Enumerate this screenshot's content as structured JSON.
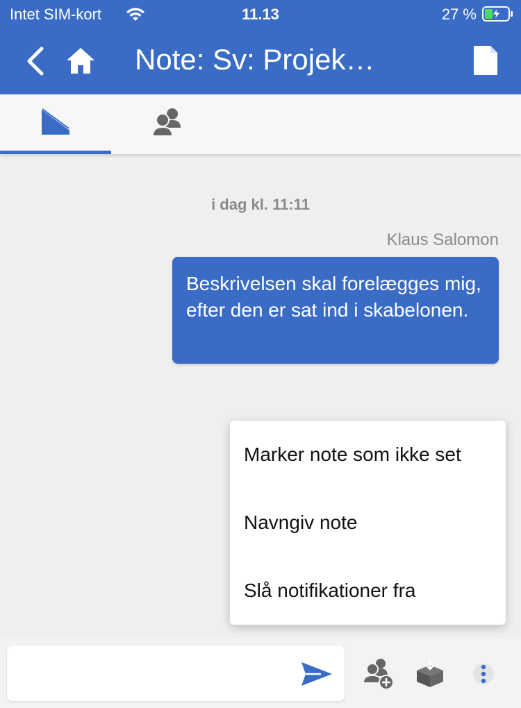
{
  "status_bar": {
    "carrier": "Intet SIM-kort",
    "time": "11.13",
    "battery": "27 %"
  },
  "header": {
    "title": "Note: Sv: Projek…",
    "background_color": "#3a6cc6"
  },
  "tabs": [
    {
      "icon": "envelope-icon",
      "active": true
    },
    {
      "icon": "participants-icon",
      "active": false
    }
  ],
  "conversation": {
    "date_separator": "i dag kl. 11:11",
    "sender": "Klaus Salomon",
    "message": "Beskrivelsen skal forelægges mig, efter den er sat ind i skabelonen."
  },
  "context_menu": {
    "items": [
      {
        "label": "Marker note som ikke set"
      },
      {
        "label": "Navngiv note"
      },
      {
        "label": "Slå notifikationer fra"
      }
    ]
  },
  "composer": {
    "placeholder": "",
    "value": ""
  },
  "colors": {
    "accent": "#3a6cc6",
    "background": "#efefef",
    "muted_text": "#8a8a8a"
  }
}
